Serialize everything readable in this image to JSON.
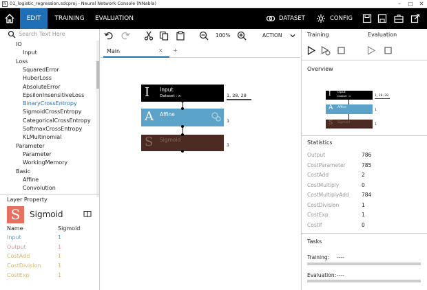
{
  "window": {
    "title": "01_logistic_regression.sdcproj - Neural Network Console (NNabla)",
    "icon_label": "N"
  },
  "menu": {
    "tabs": [
      "EDIT",
      "TRAINING",
      "EVALUATION"
    ],
    "active_tab": "EDIT",
    "dataset_label": "DATASET",
    "config_label": "CONFIG"
  },
  "search": {
    "placeholder": "Search Text Here"
  },
  "tree": {
    "items": [
      {
        "label": "IO",
        "level": 0
      },
      {
        "label": "Input",
        "level": 1
      },
      {
        "label": "Loss",
        "level": 0
      },
      {
        "label": "SquaredError",
        "level": 1
      },
      {
        "label": "HuberLoss",
        "level": 1
      },
      {
        "label": "AbsoluteError",
        "level": 1
      },
      {
        "label": "EpsilonInsensitiveLoss",
        "level": 1
      },
      {
        "label": "BinaryCrossEntropy",
        "level": 1,
        "selected": true
      },
      {
        "label": "SigmoidCrossEntropy",
        "level": 1
      },
      {
        "label": "CategoricalCrossEntropy",
        "level": 1
      },
      {
        "label": "SoftmaxCrossEntropy",
        "level": 1
      },
      {
        "label": "KLMultinomial",
        "level": 1
      },
      {
        "label": "Parameter",
        "level": 0
      },
      {
        "label": "Parameter",
        "level": 1
      },
      {
        "label": "WorkingMemory",
        "level": 1
      },
      {
        "label": "Basic",
        "level": 0
      },
      {
        "label": "Affine",
        "level": 1
      },
      {
        "label": "Convolution",
        "level": 1
      }
    ]
  },
  "layer_property": {
    "title": "Layer Property",
    "layer_letter": "S",
    "layer_name": "Sigmoid",
    "table_header": {
      "name": "Name",
      "value": "Sigmoid"
    },
    "rows": [
      {
        "name": "Input",
        "value": "1",
        "color": "#5b9bd5"
      },
      {
        "name": "Output",
        "value": "1",
        "color": "#e89a9a"
      },
      {
        "name": "CostAdd",
        "value": "1",
        "color": "#d4b86a"
      },
      {
        "name": "CostDivision",
        "value": "1",
        "color": "#d4b86a"
      },
      {
        "name": "CostExp",
        "value": "1",
        "color": "#d4b86a"
      }
    ]
  },
  "toolbar": {
    "zoom": "100%",
    "action": "ACTION"
  },
  "editor_tabs": {
    "main": "Main",
    "close": "×",
    "add": "+"
  },
  "network": {
    "layers": [
      {
        "letter": "I",
        "name": "Input",
        "sub": "Dataset : x",
        "dims": "1, 28, 28",
        "color": "#000000"
      },
      {
        "letter": "A",
        "name": "Affine",
        "sub": "",
        "dims": "1",
        "color": "#5ba3c9"
      },
      {
        "letter": "S",
        "name": "Sigmoid",
        "sub": "",
        "dims": "1",
        "color": "#4a2a22"
      }
    ]
  },
  "right": {
    "training_label": "Training",
    "evaluation_label": "Evaluation",
    "overview_label": "Overview",
    "statistics_label": "Statistics",
    "tasks_label": "Tasks",
    "statistics": [
      {
        "name": "Output",
        "value": "786"
      },
      {
        "name": "CostParameter",
        "value": "785"
      },
      {
        "name": "CostAdd",
        "value": "2"
      },
      {
        "name": "CostMultiply",
        "value": "0"
      },
      {
        "name": "CostMultiplyAdd",
        "value": "784"
      },
      {
        "name": "CostDivision",
        "value": "1"
      },
      {
        "name": "CostExp",
        "value": "1"
      },
      {
        "name": "CostIf",
        "value": "0"
      }
    ],
    "tasks": [
      {
        "label": "Training:",
        "value": "----"
      },
      {
        "label": "Evaluation:",
        "value": "----"
      }
    ]
  }
}
